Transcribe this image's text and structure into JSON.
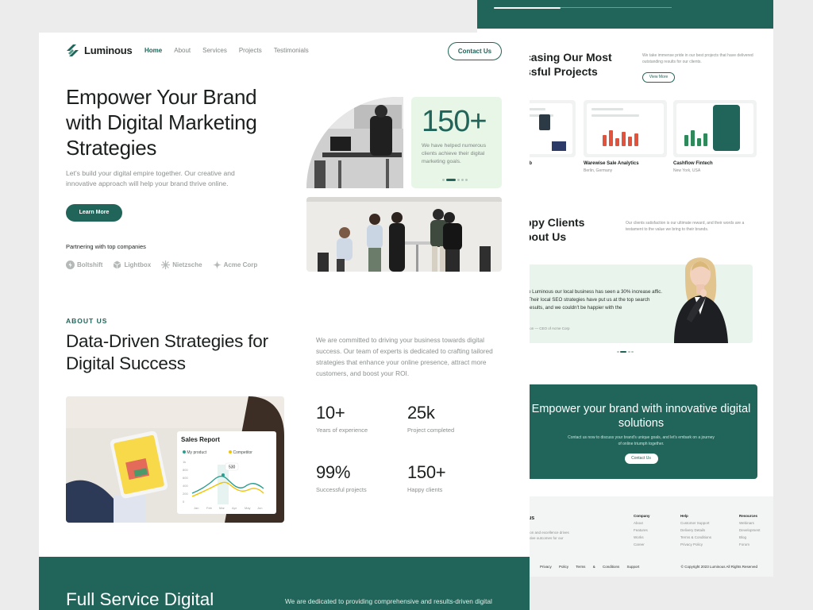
{
  "colors": {
    "brand": "#216459",
    "mint": "#e7f6e7",
    "muted": "#8a8f8d"
  },
  "header": {
    "brand": "Luminous",
    "nav": [
      "Home",
      "About",
      "Services",
      "Projects",
      "Testimonials"
    ],
    "active_nav": "Home",
    "contact_label": "Contact Us"
  },
  "hero": {
    "title": "Empower Your Brand with Digital Marketing Strategies",
    "subtitle": "Let's build your digital empire together. Our creative and innovative approach will help your brand thrive online.",
    "cta": "Learn More",
    "partners_title": "Partnering with top companies",
    "partners": [
      {
        "name": "Boltshift",
        "icon": "bolt-icon"
      },
      {
        "name": "Lightbox",
        "icon": "cube-icon"
      },
      {
        "name": "Nietzsche",
        "icon": "starburst-icon"
      },
      {
        "name": "Acme Corp",
        "icon": "sparkle-icon"
      }
    ],
    "stat_number": "150+",
    "stat_text": "We have helped numerous clients achieve their digital marketing goals."
  },
  "about": {
    "kicker": "ABOUT US",
    "title": "Data-Driven Strategies for Digital Success",
    "text": "We are committed to driving your business towards digital success. Our team of experts is dedicated to crafting tailored strategies that enhance your online presence, attract more customers, and boost your ROI.",
    "report": {
      "title": "Sales Report",
      "legend": [
        "My product",
        "Competitor"
      ],
      "tooltip": "530",
      "y_ticks": [
        "1k",
        "800",
        "600",
        "400",
        "200",
        "0"
      ],
      "x_ticks": [
        "Jan",
        "Feb",
        "Mar",
        "Apr",
        "May",
        "Jun"
      ]
    },
    "stats": [
      {
        "value": "10+",
        "label": "Years of experience"
      },
      {
        "value": "25k",
        "label": "Project completed"
      },
      {
        "value": "99%",
        "label": "Successful projects"
      },
      {
        "value": "150+",
        "label": "Happy clients"
      }
    ]
  },
  "services": {
    "title": "Full Service Digital",
    "text": "We are dedicated to providing comprehensive and results-driven digital"
  },
  "back": {
    "projects_title": "casing Our Most ssful Projects",
    "projects_title_lines": [
      "casing Our Most",
      "ssful Projects"
    ],
    "projects_desc": "We take immense pride in our best projects that have delivered outstanding results for our clients.",
    "view_more": "View More",
    "projects": [
      {
        "name": "eb",
        "location": ""
      },
      {
        "name": "Warewise Sale Analytics",
        "location": "Berlin, Germany"
      },
      {
        "name": "Cashflow Fintech",
        "location": "New York, USA"
      }
    ],
    "testimonials_title_lines": [
      "ppy Clients",
      "bout Us"
    ],
    "testimonials_desc": "Our clients satisfaction is our ultimate reward, and their words are a testament to the value we bring to their brands.",
    "quote": "o Luminous our local business has seen a 30% increase affic. Their local SEO strategies have put us at the top search results, and we couldn't be happier with the",
    "quote_author": "son — CEO of Acme Corp",
    "cta_title": "Empower your brand with innovative digital solutions",
    "cta_text": "Contact us now to discuss your brand's unique goals, and let's embark on a journey of online triumph together.",
    "cta_button": "Contact Us",
    "footer": {
      "logo": "us",
      "tagline": "tion and excellence drives ative outcomes for our",
      "columns": [
        {
          "head": "Company",
          "items": [
            "About",
            "Features",
            "Works",
            "Career"
          ]
        },
        {
          "head": "Help",
          "items": [
            "Customer Support",
            "Delivery Details",
            "Terms & Conditions",
            "Privacy Policy"
          ]
        },
        {
          "head": "Resources",
          "items": [
            "Webinars",
            "Development",
            "Blog",
            "Forum"
          ]
        }
      ],
      "bottom_links": [
        "Privacy Policy",
        "Terms & Conditions",
        "Support"
      ],
      "copyright": "© Copyright 2023 Luminous All Rights Reserved"
    }
  }
}
